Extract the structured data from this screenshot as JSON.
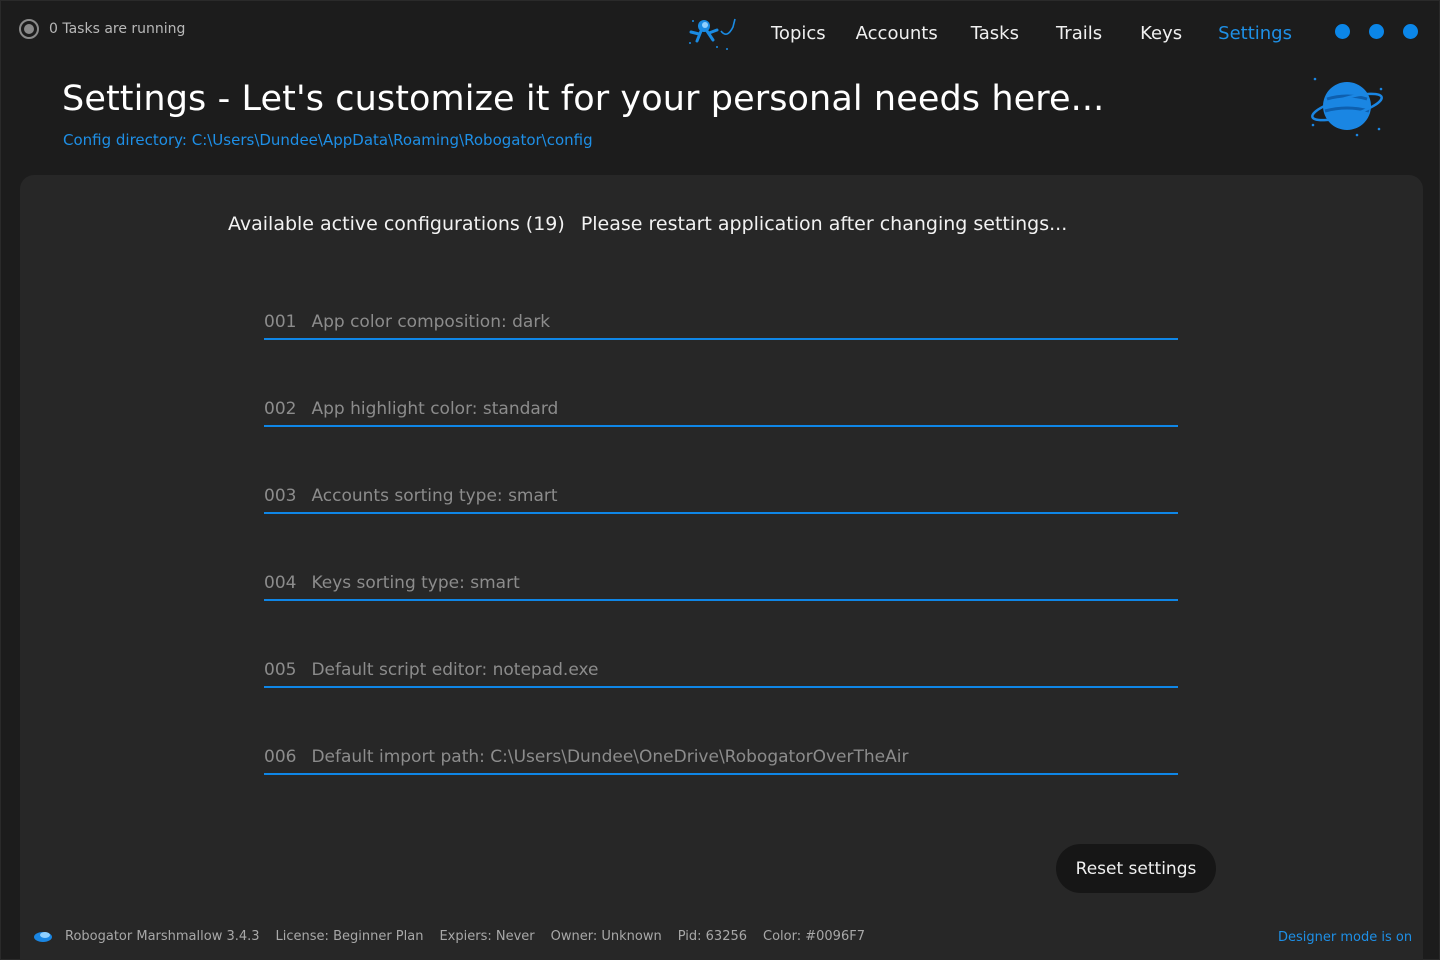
{
  "status": {
    "text": "0 Tasks are running"
  },
  "nav": {
    "items": [
      {
        "label": "Topics",
        "active": false
      },
      {
        "label": "Accounts",
        "active": false
      },
      {
        "label": "Tasks",
        "active": false
      },
      {
        "label": "Trails",
        "active": false
      },
      {
        "label": "Keys",
        "active": false
      },
      {
        "label": "Settings",
        "active": true
      }
    ],
    "mascot_icon": "astronaut-icon"
  },
  "window_controls": [
    "minimize-dot",
    "maximize-dot",
    "close-dot"
  ],
  "header": {
    "title": "Settings - Let's customize it for your personal needs here...",
    "config_directory": "Config directory: C:\\Users\\Dundee\\AppData\\Roaming\\Robogator\\config",
    "illustration_icon": "planet-icon"
  },
  "panel": {
    "available": "Available active configurations (19)",
    "restart_note": "Please restart application after changing settings...",
    "configs": [
      {
        "num": "001",
        "text": "App color composition: dark"
      },
      {
        "num": "002",
        "text": "App highlight color: standard"
      },
      {
        "num": "003",
        "text": "Accounts sorting type: smart"
      },
      {
        "num": "004",
        "text": "Keys sorting type: smart"
      },
      {
        "num": "005",
        "text": "Default script editor: notepad.exe"
      },
      {
        "num": "006",
        "text": "Default import path: C:\\Users\\Dundee\\OneDrive\\RobogatorOverTheAir"
      }
    ],
    "reset_label": "Reset settings"
  },
  "footer": {
    "app": "Robogator Marshmallow 3.4.3",
    "license": "License: Beginner Plan",
    "expires": "Expiers: Never",
    "owner": "Owner: Unknown",
    "pid": "Pid: 63256",
    "color": "Color: #0096F7",
    "designer_mode": "Designer mode is on"
  },
  "colors": {
    "accent": "#0096F7",
    "background": "#1c1c1c",
    "panel": "#272727"
  }
}
